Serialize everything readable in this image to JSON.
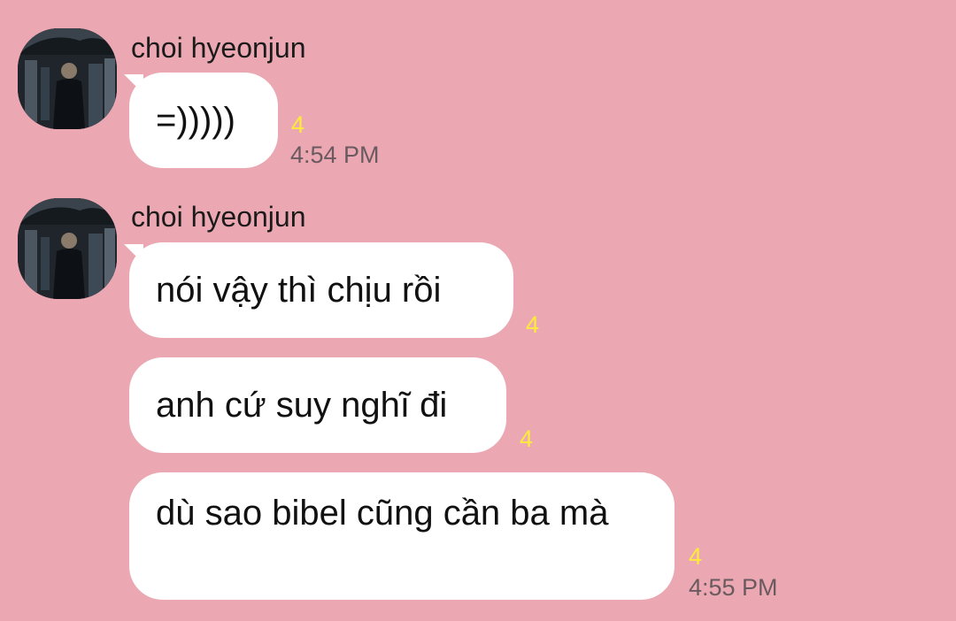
{
  "colors": {
    "background": "#eba8b2",
    "bubble": "#ffffff",
    "unread_count": "#ffeb3b",
    "timestamp": "#6a5a60"
  },
  "messages": [
    {
      "sender": "choi hyeonjun",
      "avatar_icon": "profile-photo-avatar",
      "bubbles": [
        {
          "text": "=)))))",
          "unread": "4",
          "time": "4:54 PM"
        }
      ]
    },
    {
      "sender": "choi hyeonjun",
      "avatar_icon": "profile-photo-avatar",
      "bubbles": [
        {
          "text": "nói vậy thì chịu rồi",
          "unread": "4",
          "time": ""
        },
        {
          "text": "anh cứ suy nghĩ đi",
          "unread": "4",
          "time": ""
        },
        {
          "text": "dù sao bibel cũng cần ba mà",
          "unread": "4",
          "time": "4:55 PM"
        }
      ]
    }
  ]
}
